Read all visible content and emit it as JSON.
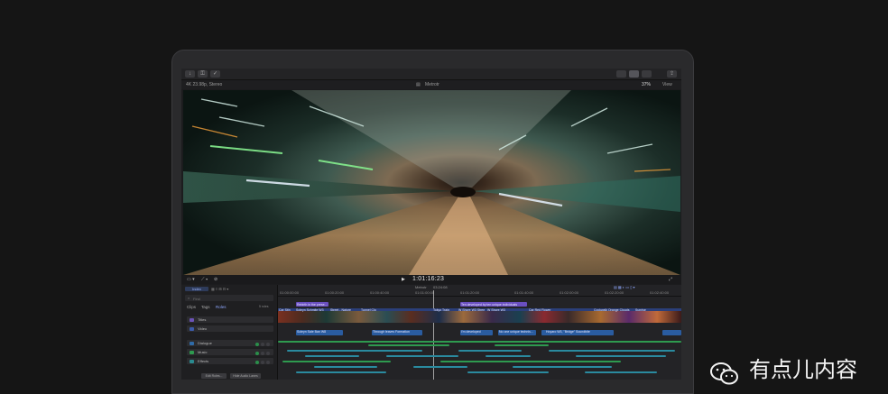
{
  "toolbar": {
    "left_icons": [
      "import-icon",
      "key-icon",
      "check-icon"
    ],
    "right_icons": [
      "browser-toggle-icon",
      "timeline-toggle-icon",
      "inspector-toggle-icon",
      "share-icon"
    ]
  },
  "viewer_info": {
    "format": "4K 23.98p, Stereo",
    "clip_name": "Metrotr",
    "zoom": "37%",
    "view_menu": "View"
  },
  "viewer_controls": {
    "play_symbol": "▶",
    "timecode": "1:01:16:23"
  },
  "timeline_header": {
    "project": "Metrotr",
    "duration": "03:24:08"
  },
  "ruler": {
    "ticks": [
      "01:00:00:00",
      "01:00:20:00",
      "01:00:40:00",
      "01:01:00:00",
      "01:01:20:00",
      "01:01:40:00",
      "01:02:00:00",
      "01:02:20:00",
      "01:02:40:00"
    ]
  },
  "browser": {
    "tab_index": "Index",
    "search_placeholder": "Find",
    "subtabs": [
      "Clips",
      "Tags",
      "Roles"
    ],
    "count": "5 roles",
    "roles": [
      "Titles",
      "Video",
      "Dialogue",
      "Music",
      "Effects"
    ],
    "buttons": [
      "Edit Roles...",
      "Hide Audio Lanes"
    ]
  },
  "timeline_labels": {
    "title_clip_1": "Rebirth in the prese...",
    "title_clip_2": "Ten developed by ten unique individuals",
    "video_clips": [
      "Car Stin",
      "Soleyn Schmite W3",
      "Street - Nature",
      "Tunnel Clo",
      "Tokyo Train",
      "W Shore W3 Stree",
      "W Shore W3",
      "Car Red Flower",
      "Cockwalk Orange Clouds",
      "Sunrise"
    ],
    "audio_clips": [
      "Soleyn Sale Ban W8",
      "Through leaves Formation",
      "I'm developed",
      "No one unique technis...",
      "Hoyaro W3, \"Bridge\" Soundbite"
    ]
  },
  "watermark": {
    "text": "有点儿内容"
  }
}
